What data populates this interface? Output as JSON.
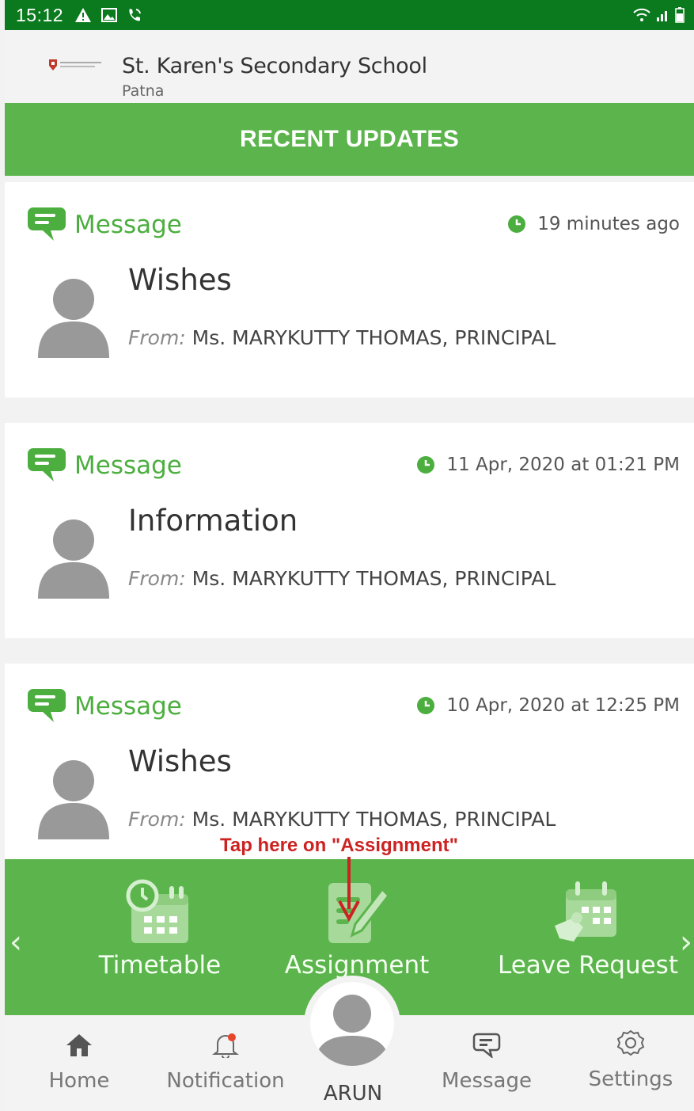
{
  "status_bar": {
    "time": "15:12"
  },
  "header": {
    "school_name": "St. Karen's Secondary School",
    "school_city": "Patna"
  },
  "banner": {
    "title": "RECENT UPDATES"
  },
  "updates": [
    {
      "type": "Message",
      "time": "19 minutes ago",
      "title": "Wishes",
      "from_label": "From:",
      "from": " Ms. MARYKUTTY THOMAS, PRINCIPAL"
    },
    {
      "type": "Message",
      "time": "11 Apr, 2020 at 01:21 PM",
      "title": "Information",
      "from_label": "From:",
      "from": " Ms. MARYKUTTY THOMAS, PRINCIPAL"
    },
    {
      "type": "Message",
      "time": "10 Apr, 2020 at 12:25 PM",
      "title": "Wishes",
      "from_label": "From:",
      "from": " Ms. MARYKUTTY THOMAS, PRINCIPAL"
    }
  ],
  "annotation": {
    "text": "Tap here on \"Assignment\""
  },
  "quick_actions": {
    "prev": "‹",
    "next": "›",
    "items": [
      {
        "label": "Timetable"
      },
      {
        "label": "Assignment"
      },
      {
        "label": "Leave Request"
      }
    ]
  },
  "bottom_nav": {
    "home": "Home",
    "notification": "Notification",
    "profile_name": "ARUN",
    "message": "Message",
    "settings": "Settings"
  },
  "colors": {
    "status_bar": "#0b7a1f",
    "accent_green": "#5cb54c",
    "annotation_red": "#cc2222"
  }
}
